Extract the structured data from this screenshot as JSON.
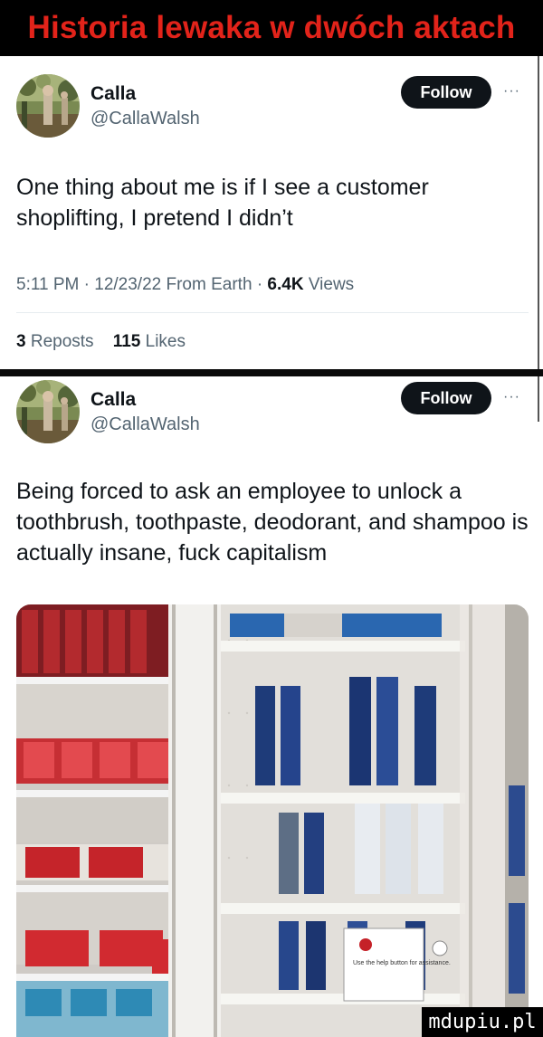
{
  "banner": {
    "title": "Historia lewaka w dwóch aktach",
    "title_color": "#e2231a"
  },
  "tweets": [
    {
      "name": "Calla",
      "handle": "@CallaWalsh",
      "follow_label": "Follow",
      "more_label": "···",
      "text": "One thing about me is if I see a customer shoplifting, I pretend I didn’t",
      "time": "5:11 PM",
      "date": "12/23/22",
      "source": "From Earth",
      "views_count": "6.4K",
      "views_label": "Views",
      "reposts_count": "3",
      "reposts_label": "Reposts",
      "likes_count": "115",
      "likes_label": "Likes"
    },
    {
      "name": "Calla",
      "handle": "@CallaWalsh",
      "follow_label": "Follow",
      "more_label": "···",
      "text": "Being forced to ask an employee to unlock a toothbrush, toothpaste, deodorant, and shampoo is actually insane, fuck capitalism",
      "photo": {
        "subject": "locked toothbrush and toothpaste display cases in a store aisle",
        "sign_text": "Use the help button for assistance."
      }
    }
  ],
  "watermark": {
    "text": "mdupiu.pl"
  }
}
